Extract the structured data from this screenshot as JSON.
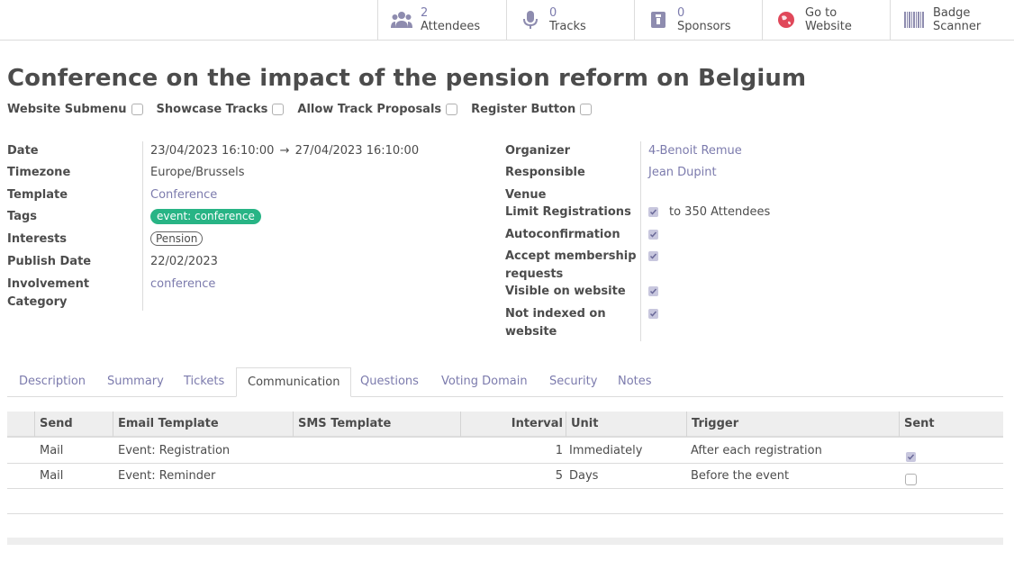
{
  "smart_buttons": [
    {
      "count": "2",
      "label": "Attendees",
      "icon": "users-icon"
    },
    {
      "count": "0",
      "label": "Tracks",
      "icon": "microphone-icon"
    },
    {
      "count": "0",
      "label": "Sponsors",
      "icon": "sponsor-badge-icon"
    },
    {
      "line1": "Go to",
      "line2": "Website",
      "icon": "globe-icon"
    },
    {
      "line1": "Badge",
      "line2": "Scanner",
      "icon": "barcode-icon"
    }
  ],
  "title": "Conference on the impact of the pension reform on Belgium",
  "options": [
    {
      "label": "Website Submenu",
      "checked": false
    },
    {
      "label": "Showcase Tracks",
      "checked": false
    },
    {
      "label": "Allow Track Proposals",
      "checked": false
    },
    {
      "label": "Register Button",
      "checked": false
    }
  ],
  "left_fields": {
    "date_label": "Date",
    "date_start": "23/04/2023 16:10:00",
    "date_arrow": "→",
    "date_end": "27/04/2023 16:10:00",
    "timezone_label": "Timezone",
    "timezone": "Europe/Brussels",
    "template_label": "Template",
    "template": "Conference",
    "tags_label": "Tags",
    "tag": "event: conference",
    "interests_label": "Interests",
    "interest": "Pension",
    "publish_label": "Publish Date",
    "publish_date": "22/02/2023",
    "involvement_label_1": "Involvement",
    "involvement_label_2": "Category",
    "involvement": "conference"
  },
  "right_fields": {
    "organizer_label": "Organizer",
    "organizer": "4-Benoit Remue",
    "responsible_label": "Responsible",
    "responsible": "Jean Dupint",
    "venue_label": "Venue",
    "limit_label": "Limit Registrations",
    "limit_value": "to 350 Attendees",
    "autoconfirm_label": "Autoconfirmation",
    "membership_label_1": "Accept membership",
    "membership_label_2": "requests",
    "visible_label": "Visible on website",
    "notindexed_label_1": "Not indexed on",
    "notindexed_label_2": "website"
  },
  "tabs": [
    "Description",
    "Summary",
    "Tickets",
    "Communication",
    "Questions",
    "Voting Domain",
    "Security",
    "Notes"
  ],
  "active_tab": "Communication",
  "table": {
    "columns": [
      "Send",
      "Email Template",
      "SMS Template",
      "Interval",
      "Unit",
      "Trigger",
      "Sent"
    ],
    "rows": [
      {
        "send": "Mail",
        "email_template": "Event: Registration",
        "sms_template": "",
        "interval": "1",
        "unit": "Immediately",
        "trigger": "After each registration",
        "sent": true
      },
      {
        "send": "Mail",
        "email_template": "Event: Reminder",
        "sms_template": "",
        "interval": "5",
        "unit": "Days",
        "trigger": "Before the event",
        "sent": false
      }
    ]
  },
  "colors": {
    "link": "#7c7bad",
    "tag_green": "#28b485",
    "text": "#4c4c4c"
  }
}
